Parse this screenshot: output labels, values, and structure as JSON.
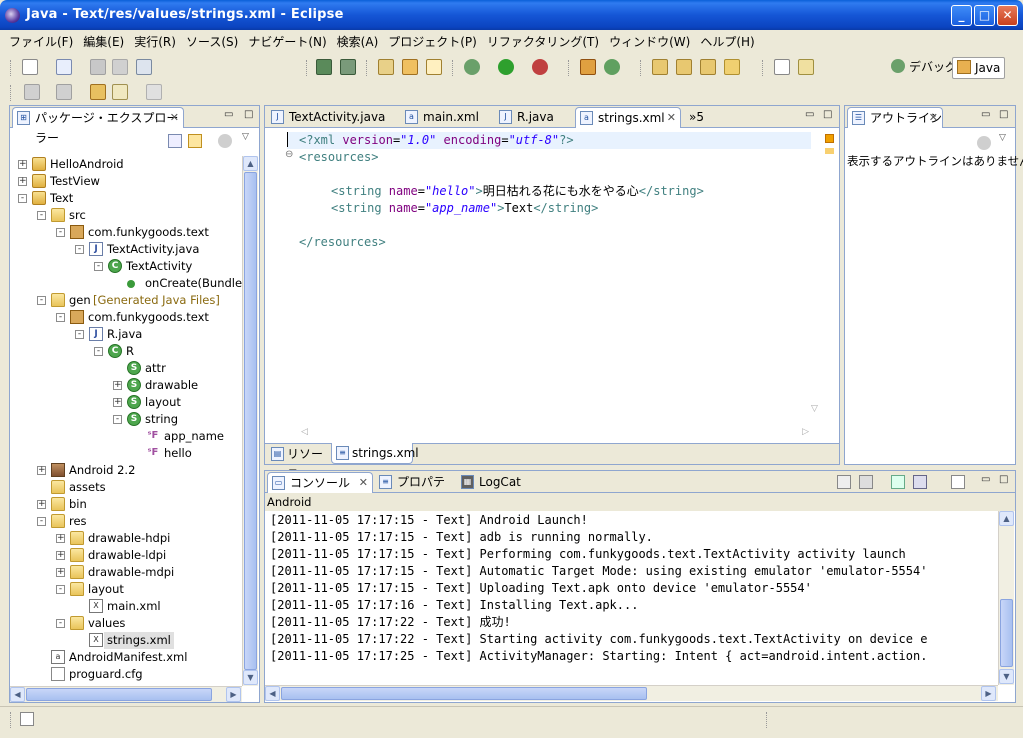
{
  "window": {
    "title": "Java - Text/res/values/strings.xml - Eclipse"
  },
  "menu": [
    "ファイル(F)",
    "編集(E)",
    "実行(R)",
    "ソース(S)",
    "ナビゲート(N)",
    "検索(A)",
    "プロジェクト(P)",
    "リファクタリング(T)",
    "ウィンドウ(W)",
    "ヘルプ(H)"
  ],
  "perspectives": {
    "debug": "デバッグ",
    "java": "Java"
  },
  "explorer": {
    "title": "パッケージ・エクスプローラー",
    "items": [
      {
        "label": "HelloAndroid"
      },
      {
        "label": "TestView"
      },
      {
        "label": "Text"
      },
      {
        "label": "src"
      },
      {
        "label": "com.funkygoods.text"
      },
      {
        "label": "TextActivity.java"
      },
      {
        "label": "TextActivity"
      },
      {
        "label": "onCreate(Bundle)"
      },
      {
        "label": "gen",
        "suffix": "[Generated Java Files]"
      },
      {
        "label": "com.funkygoods.text"
      },
      {
        "label": "R.java"
      },
      {
        "label": "R"
      },
      {
        "label": "attr"
      },
      {
        "label": "drawable"
      },
      {
        "label": "layout"
      },
      {
        "label": "string"
      },
      {
        "label": "app_name"
      },
      {
        "label": "hello"
      },
      {
        "label": "Android 2.2"
      },
      {
        "label": "assets"
      },
      {
        "label": "bin"
      },
      {
        "label": "res"
      },
      {
        "label": "drawable-hdpi"
      },
      {
        "label": "drawable-ldpi"
      },
      {
        "label": "drawable-mdpi"
      },
      {
        "label": "layout"
      },
      {
        "label": "main.xml"
      },
      {
        "label": "values"
      },
      {
        "label": "strings.xml"
      },
      {
        "label": "AndroidManifest.xml"
      },
      {
        "label": "proguard.cfg"
      }
    ]
  },
  "editor": {
    "tabs": [
      "TextActivity.java",
      "main.xml",
      "R.java",
      "strings.xml"
    ],
    "overflow": "»5",
    "line1": {
      "pi_open": "<?xml ",
      "a1": "version",
      "eq": "=",
      "v1": "\"1.0\"",
      "a2": "encoding",
      "v2": "\"utf-8\"",
      "pi_close": "?>"
    },
    "line2": "<resources>",
    "line3": {
      "open": "<string ",
      "attr": "name",
      "val": "\"hello\"",
      "close": ">",
      "text": "明日枯れる花にも水をやる心",
      "end": "</string>"
    },
    "line4": {
      "open": "<string ",
      "attr": "name",
      "val": "\"app_name\"",
      "close": ">",
      "text": "Text",
      "end": "</string>"
    },
    "line5": "</resources>",
    "bottom_tabs": [
      "リソース",
      "strings.xml"
    ]
  },
  "outline": {
    "title": "アウトライン",
    "message": "表示するアウトラインはありません。"
  },
  "console": {
    "tabs": [
      "コンソール",
      "プロパティー",
      "LogCat"
    ],
    "subtitle": "Android",
    "lines": [
      "[2011-11-05 17:17:15 - Text] Android Launch!",
      "[2011-11-05 17:17:15 - Text] adb is running normally.",
      "[2011-11-05 17:17:15 - Text] Performing com.funkygoods.text.TextActivity activity launch",
      "[2011-11-05 17:17:15 - Text] Automatic Target Mode: using existing emulator 'emulator-5554'",
      "[2011-11-05 17:17:15 - Text] Uploading Text.apk onto device 'emulator-5554'",
      "[2011-11-05 17:17:16 - Text] Installing Text.apk...",
      "[2011-11-05 17:17:22 - Text] 成功!",
      "[2011-11-05 17:17:22 - Text] Starting activity com.funkygoods.text.TextActivity on device e",
      "[2011-11-05 17:17:25 - Text] ActivityManager: Starting: Intent { act=android.intent.action."
    ]
  }
}
